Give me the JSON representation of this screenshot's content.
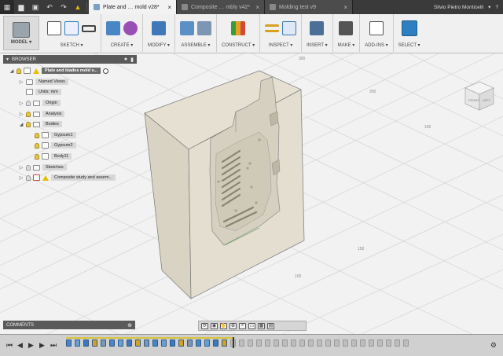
{
  "window": {
    "tabs": [
      {
        "label": "Plate and … mold v28*",
        "active": true
      },
      {
        "label": "Composite … mbly v42*",
        "active": false
      },
      {
        "label": "Molding test v9",
        "active": false
      }
    ],
    "user": "Silvio Pietro Monticelli"
  },
  "toolbar": {
    "model": "MODEL ▾",
    "groups": [
      "SKETCH ▾",
      "CREATE ▾",
      "MODIFY ▾",
      "ASSEMBLE ▾",
      "CONSTRUCT ▾",
      "INSPECT ▾",
      "INSERT ▾",
      "MAKE ▾",
      "ADD-INS ▾",
      "SELECT ▾"
    ]
  },
  "browser": {
    "title": "BROWSER",
    "root": "Plate and blades mold v...",
    "items": [
      "Named Views",
      "Units: mm",
      "Origin",
      "Analysis",
      "Bodies",
      "Gypsum1",
      "Gypsum2",
      "Body11",
      "Sketches",
      "Composite study and assem..."
    ]
  },
  "comments": {
    "title": "COMMENTS"
  },
  "viewcube": {
    "front": "FRONT",
    "right": "LEFT",
    "top": "TOP"
  },
  "colors": {
    "accent": "#2d7fc1",
    "body_face": "#e6e0d2",
    "warning": "#e5c000"
  }
}
